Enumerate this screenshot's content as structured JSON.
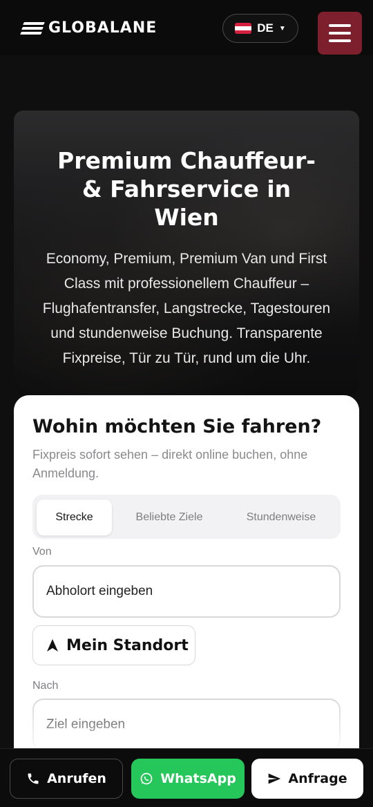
{
  "header": {
    "brand": "GLOBALANE",
    "language": "DE",
    "flag_colors": [
      "#d5213f",
      "#ffffff",
      "#d5213f"
    ],
    "menu_icon": "hamburger-icon",
    "menu_color": "#7d1f2c"
  },
  "hero": {
    "title": "Premium Chauffeur- & Fahrservice in Wien",
    "subtitle": "Economy, Premium, Premium Van und First Class mit professionellem Chauffeur – Flughafentransfer, Langstrecke, Tagestouren und stundenweise Buchung. Transparente Fixpreise, Tür zu Tür, rund um die Uhr."
  },
  "booking": {
    "title": "Wohin möchten Sie fahren?",
    "subtitle": "Fixpreis sofort sehen – direkt online buchen, ohne Anmeldung.",
    "tabs": [
      {
        "label": "Strecke",
        "active": true
      },
      {
        "label": "Beliebte Ziele",
        "active": false
      },
      {
        "label": "Stundenweise",
        "active": false
      }
    ],
    "from_label": "Von",
    "from_placeholder": "Abholort eingeben",
    "location_button": "Mein Standort",
    "to_label": "Nach",
    "to_placeholder": "Ziel eingeben"
  },
  "actions": {
    "call": "Anrufen",
    "whatsapp": "WhatsApp",
    "request": "Anfrage",
    "whatsapp_color": "#25c65a"
  }
}
